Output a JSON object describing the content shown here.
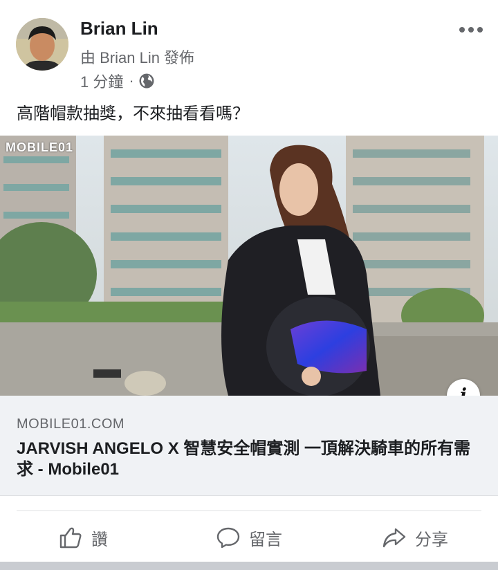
{
  "post": {
    "author_name": "Brian Lin",
    "posted_by": "由 Brian Lin 發佈",
    "time": "1 分鐘",
    "separator": "·",
    "text": "高階帽款抽獎，不來抽看看嗎？"
  },
  "photo": {
    "watermark": "MOBILE01"
  },
  "link_card": {
    "domain": "MOBILE01.COM",
    "title": "JARVISH ANGELO X 智慧安全帽實測 一頂解決騎車的所有需求 - Mobile01",
    "info_icon": "i"
  },
  "actions": {
    "like": "讚",
    "comment": "留言",
    "share": "分享"
  },
  "icons": {
    "more": "more-icon",
    "globe": "globe-icon",
    "like": "thumbs-up-icon",
    "comment": "comment-icon",
    "share": "share-icon"
  },
  "colors": {
    "text": "#1c1e21",
    "secondary": "#65676b",
    "card_bg": "#f0f2f5"
  }
}
